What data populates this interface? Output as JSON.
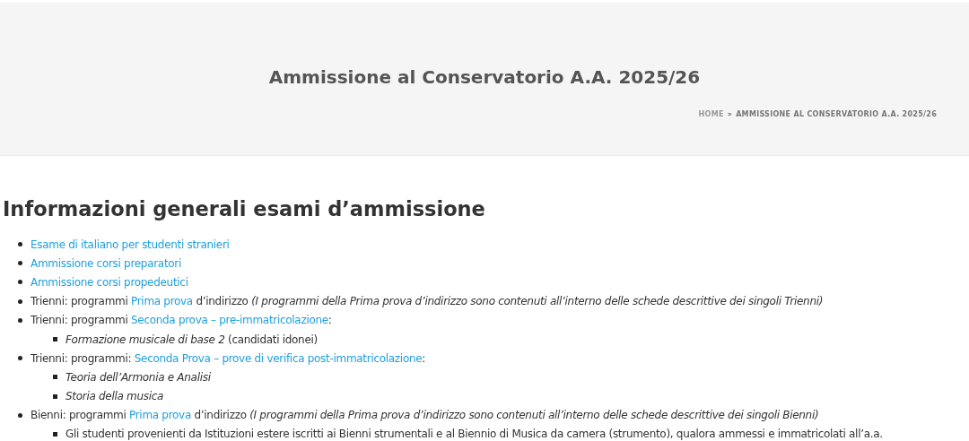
{
  "header": {
    "title": "Ammissione al Conservatorio A.A. 2025/26",
    "breadcrumb": [
      {
        "kind": "link",
        "text": "HOME"
      },
      {
        "kind": "sep",
        "text": "»"
      },
      {
        "kind": "current",
        "text": "AMMISSIONE AL CONSERVATORIO A.A. 2025/26"
      }
    ]
  },
  "content": {
    "heading": "Informazioni generali esami d’ammissione",
    "items": [
      {
        "parts": [
          {
            "kind": "link",
            "text": "Esame di italiano per studenti stranieri"
          }
        ]
      },
      {
        "parts": [
          {
            "kind": "link",
            "text": "Ammissione corsi preparatori"
          }
        ]
      },
      {
        "parts": [
          {
            "kind": "link",
            "text": "Ammissione corsi propedeutici"
          }
        ]
      },
      {
        "parts": [
          {
            "kind": "text",
            "text": "Trienni: programmi "
          },
          {
            "kind": "link",
            "text": "Prima prova"
          },
          {
            "kind": "text",
            "text": " d’indirizzo "
          },
          {
            "kind": "italic",
            "text": "(I programmi della Prima prova d’indirizzo sono contenuti all’interno delle schede descrittive dei singoli Trienni)"
          }
        ]
      },
      {
        "parts": [
          {
            "kind": "text",
            "text": "Trienni: programmi "
          },
          {
            "kind": "link",
            "text": "Seconda prova – pre-immatricolazione"
          },
          {
            "kind": "text",
            "text": ":"
          }
        ],
        "children": [
          {
            "parts": [
              {
                "kind": "italic",
                "text": "Formazione musicale di base 2"
              },
              {
                "kind": "text",
                "text": " (candidati idonei)"
              }
            ]
          }
        ]
      },
      {
        "parts": [
          {
            "kind": "text",
            "text": "Trienni: programmi: "
          },
          {
            "kind": "link",
            "text": "Seconda Prova – prove di verifica post-immatricolazione"
          },
          {
            "kind": "text",
            "text": ":"
          }
        ],
        "children": [
          {
            "parts": [
              {
                "kind": "italic",
                "text": "Teoria dell’Armonia e Analisi"
              }
            ]
          },
          {
            "parts": [
              {
                "kind": "italic",
                "text": "Storia della musica"
              }
            ]
          }
        ]
      },
      {
        "parts": [
          {
            "kind": "text",
            "text": "Bienni: programmi "
          },
          {
            "kind": "link",
            "text": "Prima prova"
          },
          {
            "kind": "text",
            "text": " d’indirizzo "
          },
          {
            "kind": "italic",
            "text": "(I programmi della Prima prova d’indirizzo sono contenuti all’interno delle schede descrittive dei singoli Bienni)"
          }
        ],
        "children": [
          {
            "parts": [
              {
                "kind": "text",
                "text": "Gli studenti provenienti da Istituzioni estere iscritti ai Bienni strumentali e al Biennio di Musica da camera (strumento), qualora ammessi e immatricolati all’a.a."
              }
            ]
          }
        ]
      }
    ]
  }
}
